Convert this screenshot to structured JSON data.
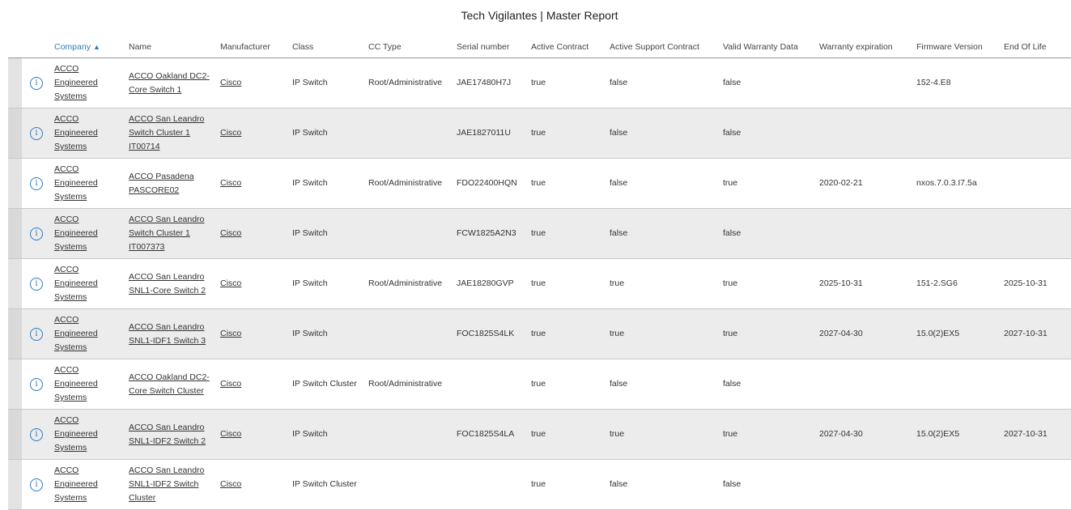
{
  "report": {
    "title": "Tech Vigilantes | Master Report"
  },
  "columns": {
    "company": "Company",
    "name": "Name",
    "manufacturer": "Manufacturer",
    "class": "Class",
    "cc_type": "CC Type",
    "serial": "Serial number",
    "active_contract": "Active Contract",
    "active_support": "Active Support Contract",
    "warranty_valid": "Valid Warranty Data",
    "warranty_exp": "Warranty expiration",
    "firmware": "Firmware Version",
    "eol": "End Of Life"
  },
  "sort": {
    "column": "company",
    "direction": "ascending",
    "arrow": "▲"
  },
  "icons": {
    "info": "info-circle-icon",
    "sort": "sort-ascending-icon"
  },
  "colors": {
    "accent": "#2f7bbf",
    "row_alt": "#ececec"
  },
  "rows": [
    {
      "company": [
        "ACCO",
        "Engineered",
        "Systems"
      ],
      "name": [
        "ACCO Oakland DC2-",
        "Core Switch 1"
      ],
      "manufacturer": "Cisco",
      "class": "IP Switch",
      "cc_type": "Root/Administrative",
      "serial": "JAE17480H7J",
      "active_contract": "true",
      "active_support": "false",
      "warranty_valid": "false",
      "warranty_exp": "",
      "firmware": "152-4.E8",
      "eol": ""
    },
    {
      "company": [
        "ACCO",
        "Engineered",
        "Systems"
      ],
      "name": [
        "ACCO San Leandro",
        "Switch Cluster 1",
        "IT00714"
      ],
      "manufacturer": "Cisco",
      "class": "IP Switch",
      "cc_type": "",
      "serial": "JAE1827011U",
      "active_contract": "true",
      "active_support": "false",
      "warranty_valid": "false",
      "warranty_exp": "",
      "firmware": "",
      "eol": ""
    },
    {
      "company": [
        "ACCO",
        "Engineered",
        "Systems"
      ],
      "name": [
        "ACCO Pasadena",
        "PASCORE02"
      ],
      "manufacturer": "Cisco",
      "class": "IP Switch",
      "cc_type": "Root/Administrative",
      "serial": "FDO22400HQN",
      "active_contract": "true",
      "active_support": "false",
      "warranty_valid": "true",
      "warranty_exp": "2020-02-21",
      "firmware": "nxos.7.0.3.I7.5a",
      "eol": ""
    },
    {
      "company": [
        "ACCO",
        "Engineered",
        "Systems"
      ],
      "name": [
        "ACCO San Leandro",
        "Switch Cluster 1",
        "IT007373"
      ],
      "manufacturer": "Cisco",
      "class": "IP Switch",
      "cc_type": "",
      "serial": "FCW1825A2N3",
      "active_contract": "true",
      "active_support": "false",
      "warranty_valid": "false",
      "warranty_exp": "",
      "firmware": "",
      "eol": ""
    },
    {
      "company": [
        "ACCO",
        "Engineered",
        "Systems"
      ],
      "name": [
        "ACCO San Leandro",
        "SNL1-Core Switch 2"
      ],
      "manufacturer": "Cisco",
      "class": "IP Switch",
      "cc_type": "Root/Administrative",
      "serial": "JAE18280GVP",
      "active_contract": "true",
      "active_support": "true",
      "warranty_valid": "true",
      "warranty_exp": "2025-10-31",
      "firmware": "151-2.SG6",
      "eol": "2025-10-31"
    },
    {
      "company": [
        "ACCO",
        "Engineered",
        "Systems"
      ],
      "name": [
        "ACCO San Leandro",
        "SNL1-IDF1 Switch 3"
      ],
      "manufacturer": "Cisco",
      "class": "IP Switch",
      "cc_type": "",
      "serial": "FOC1825S4LK",
      "active_contract": "true",
      "active_support": "true",
      "warranty_valid": "true",
      "warranty_exp": "2027-04-30",
      "firmware": "15.0(2)EX5",
      "eol": "2027-10-31"
    },
    {
      "company": [
        "ACCO",
        "Engineered",
        "Systems"
      ],
      "name": [
        "ACCO Oakland DC2-",
        "Core Switch Cluster"
      ],
      "manufacturer": "Cisco",
      "class": "IP Switch Cluster",
      "cc_type": "Root/Administrative",
      "serial": "",
      "active_contract": "true",
      "active_support": "false",
      "warranty_valid": "false",
      "warranty_exp": "",
      "firmware": "",
      "eol": ""
    },
    {
      "company": [
        "ACCO",
        "Engineered",
        "Systems"
      ],
      "name": [
        "ACCO San Leandro",
        "SNL1-IDF2 Switch 2"
      ],
      "manufacturer": "Cisco",
      "class": "IP Switch",
      "cc_type": "",
      "serial": "FOC1825S4LA",
      "active_contract": "true",
      "active_support": "true",
      "warranty_valid": "true",
      "warranty_exp": "2027-04-30",
      "firmware": "15.0(2)EX5",
      "eol": "2027-10-31"
    },
    {
      "company": [
        "ACCO",
        "Engineered",
        "Systems"
      ],
      "name": [
        "ACCO San Leandro",
        "SNL1-IDF2 Switch",
        "Cluster"
      ],
      "manufacturer": "Cisco",
      "class": "IP Switch Cluster",
      "cc_type": "",
      "serial": "",
      "active_contract": "true",
      "active_support": "false",
      "warranty_valid": "false",
      "warranty_exp": "",
      "firmware": "",
      "eol": ""
    }
  ]
}
